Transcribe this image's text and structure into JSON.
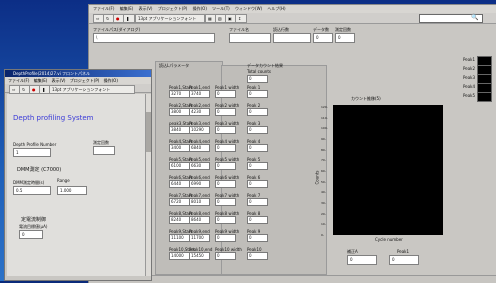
{
  "main": {
    "menu": [
      "ファイル(F)",
      "編集(E)",
      "表示(V)",
      "プロジェクト(P)",
      "操作(O)",
      "ツール(T)",
      "ウィンドウ(W)",
      "ヘルプ(H)"
    ],
    "toolbar": {
      "font": "13pt アプリケーションフォント",
      "search_icon": "search-icon"
    },
    "file_label": "ファイルパス(ダイアログ)",
    "file_path": "\\",
    "fields": {
      "filename_label": "ファイル名",
      "filename_value": "",
      "rate_label": "読込行数",
      "rate_value": "",
      "data_label": "データ数",
      "data_value": "0",
      "count_label": "測定回数",
      "count_value": "0"
    },
    "peak_list_label": "読込Lパラメータ",
    "data_result_label": "データカウント結果",
    "total_counts_label": "Total counts",
    "total_counts_value": "0",
    "peaks": [
      {
        "start_label": "Peak1,Start",
        "start": "3270",
        "end_label": "Peak1,end",
        "end": "3740",
        "width_label": "Peak1 width",
        "width": "0",
        "count_label": "Peak 1",
        "count": "0"
      },
      {
        "start_label": "Peak2,Start",
        "start": "3800",
        "end_label": "Peak2,end",
        "end": "4230",
        "width_label": "Peak2 width",
        "width": "0",
        "count_label": "Peak 2",
        "count": "0"
      },
      {
        "start_label": "peak3,Start",
        "start": "3840",
        "end_label": "Peak3,end",
        "end": "10290",
        "width_label": "Peak3 width",
        "width": "0",
        "count_label": "Peak 3",
        "count": "0"
      },
      {
        "start_label": "Peak4,Start",
        "start": "3400",
        "end_label": "Peak4,end",
        "end": "6840",
        "width_label": "Peak4 width",
        "width": "0",
        "count_label": "Peak 4",
        "count": "0"
      },
      {
        "start_label": "Peak5,Start",
        "start": "6100",
        "end_label": "Peak5,end",
        "end": "6630",
        "width_label": "Peak5 width",
        "width": "0",
        "count_label": "Peak 5",
        "count": "0"
      },
      {
        "start_label": "Peak6,Start",
        "start": "6440",
        "end_label": "Peak6,end",
        "end": "6990",
        "width_label": "Peak6 width",
        "width": "0",
        "count_label": "Peak 6",
        "count": "0"
      },
      {
        "start_label": "Peak7,Start",
        "start": "6720",
        "end_label": "Peak7,end",
        "end": "8010",
        "width_label": "Peak7 width",
        "width": "0",
        "count_label": "Peak 7",
        "count": "0"
      },
      {
        "start_label": "Peak8,Start",
        "start": "8240",
        "end_label": "Peak8,end",
        "end": "8640",
        "width_label": "Peak8 width",
        "width": "0",
        "count_label": "Peak 8",
        "count": "0"
      },
      {
        "start_label": "Peak9,Start",
        "start": "11100",
        "end_label": "Peak9,end",
        "end": "11700",
        "width_label": "Peak9 width",
        "width": "0",
        "count_label": "Peak 9",
        "count": "0"
      },
      {
        "start_label": "Peak10,Start",
        "start": "14000",
        "end_label": "Peak10,end",
        "end": "15450",
        "width_label": "Peak10 width",
        "width": "0",
        "count_label": "Peak10",
        "count": "0"
      }
    ],
    "graph": {
      "title": "カウント推移(5)",
      "y_label": "Counts",
      "x_label": "Cycle number",
      "y_ticks": [
        "120-",
        "110-",
        "100-",
        "90-",
        "80-",
        "70-",
        "60-",
        "50-",
        "40-",
        "30-",
        "20-",
        "10-",
        "0-"
      ]
    },
    "legend": [
      "Peak1",
      "Peak2",
      "Peak3",
      "Peak4",
      "Peak5"
    ],
    "bottom": {
      "label_a": "補正A",
      "label_b": "Peak1",
      "value_a": "0",
      "value_b": "0"
    }
  },
  "sub": {
    "title": "DepthProfile(2014)27.vi フロントパネル",
    "menu": [
      "ファイル(F)",
      "編集(E)",
      "表示(V)",
      "プロジェクト(P)",
      "操作(O)"
    ],
    "toolbar_font": "13pt アプリケーションフォント",
    "heading": "Depth profiling System",
    "profile_number_label": "Depth Profile Number",
    "profile_number_value": "1",
    "measure_count_label": "測定回数",
    "measure_count_value": "",
    "dmm_label": "DMM測定 (C7000)",
    "dmm_setting_label": "DMM測定時間(s)",
    "dmm_setting_value": "0.5",
    "range_label": "Range",
    "range_value": "1.000",
    "accel_label": "定電流制御",
    "accel_sub": "電流目標値(μA)",
    "accel_value": "0"
  },
  "colors": {
    "desktop": "#1f5fb8",
    "graph_bg": "#000000",
    "heading": "#3a3ad8"
  }
}
